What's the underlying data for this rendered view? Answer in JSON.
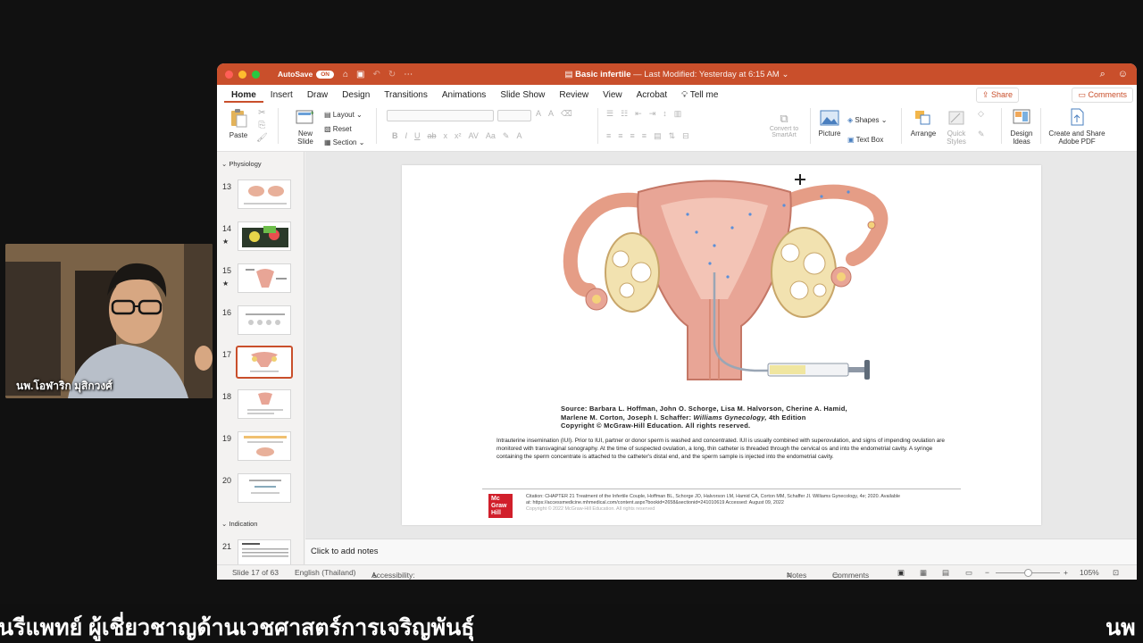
{
  "window": {
    "autosave_label": "AutoSave",
    "autosave_state": "ON",
    "doc_name": "Basic infertile",
    "doc_modified": "— Last Modified: Yesterday at 6:15 AM ⌄"
  },
  "tabs": [
    "Home",
    "Insert",
    "Draw",
    "Design",
    "Transitions",
    "Animations",
    "Slide Show",
    "Review",
    "View",
    "Acrobat",
    "Tell me"
  ],
  "share_label": "Share",
  "comments_label": "Comments",
  "ribbon": {
    "paste": "Paste",
    "new_slide_1": "New",
    "new_slide_2": "Slide",
    "layout": "Layout",
    "reset": "Reset",
    "section": "Section",
    "convert_1": "Convert to",
    "convert_2": "SmartArt",
    "picture": "Picture",
    "shapes": "Shapes",
    "text_box": "Text Box",
    "arrange": "Arrange",
    "quick_1": "Quick",
    "quick_2": "Styles",
    "design_ideas_1": "Design",
    "design_ideas_2": "Ideas",
    "adobe_1": "Create and Share",
    "adobe_2": "Adobe PDF"
  },
  "sections": {
    "physiology": "Physiology",
    "indication": "Indication"
  },
  "thumbnails": [
    {
      "num": "13",
      "star": ""
    },
    {
      "num": "14",
      "star": "★"
    },
    {
      "num": "15",
      "star": "★"
    },
    {
      "num": "16",
      "star": ""
    },
    {
      "num": "17",
      "star": ""
    },
    {
      "num": "18",
      "star": ""
    },
    {
      "num": "19",
      "star": ""
    },
    {
      "num": "20",
      "star": ""
    },
    {
      "num": "21",
      "star": ""
    }
  ],
  "slide": {
    "source_line1": "Source: Barbara L. Hoffman, John O. Schorge, Lisa M. Halvorson, Cherine A. Hamid,",
    "source_line2_a": "Marlene M. Corton, Joseph I. Schaffer:",
    "source_line2_b": "Williams Gynecology,",
    "source_line2_c": "4th Edition",
    "source_line3": "Copyright © McGraw-Hill Education. All rights reserved.",
    "body": "Intrauterine insemination (IUI). Prior to IUI, partner or donor sperm is washed and concentrated. IUI is usually combined with superovulation, and signs of impending ovulation are monitored with transvaginal sonography. At the time of suspected ovulation, a long, thin catheter is threaded through the cervical os and into the endometrial cavity. A syringe containing the sperm concentrate is attached to the catheter's distal end, and the sperm sample is injected into the endometrial cavity.",
    "logo_1": "Mc",
    "logo_2": "Graw",
    "logo_3": "Hill",
    "citation_1": "Citation: CHAPTER 21 Treatment of the Infertile Couple, Hoffman BL, Schorge JO, Halvorson LM, Hamid CA, Corton MM, Schaffer JI. Williams Gynecology, 4e; 2020. Available",
    "citation_2": "at: https://accessmedicine.mhmedical.com/content.aspx?bookid=2658&sectionid=241010619 Accessed: August 09, 2022",
    "citation_3": "Copyright © 2022 McGraw-Hill Education. All rights reserved"
  },
  "notes_placeholder": "Click to add notes",
  "status": {
    "slide": "Slide 17 of 63",
    "language": "English (Thailand)",
    "accessibility": "Accessibility: Investigate",
    "notes": "Notes",
    "comments": "Comments",
    "zoom": "105%"
  },
  "webcam": {
    "name_label": "นพ.โอฬาริก มุสิกวงศ์"
  },
  "ticker": {
    "text": "ันรีแพทย์ ผู้เชี่ยวชาญด้านเวชศาสตร์การเจริญพันธุ์",
    "text_tail": "นพ"
  },
  "colors": {
    "accent": "#c94f2b",
    "uterus": "#e8a596"
  }
}
